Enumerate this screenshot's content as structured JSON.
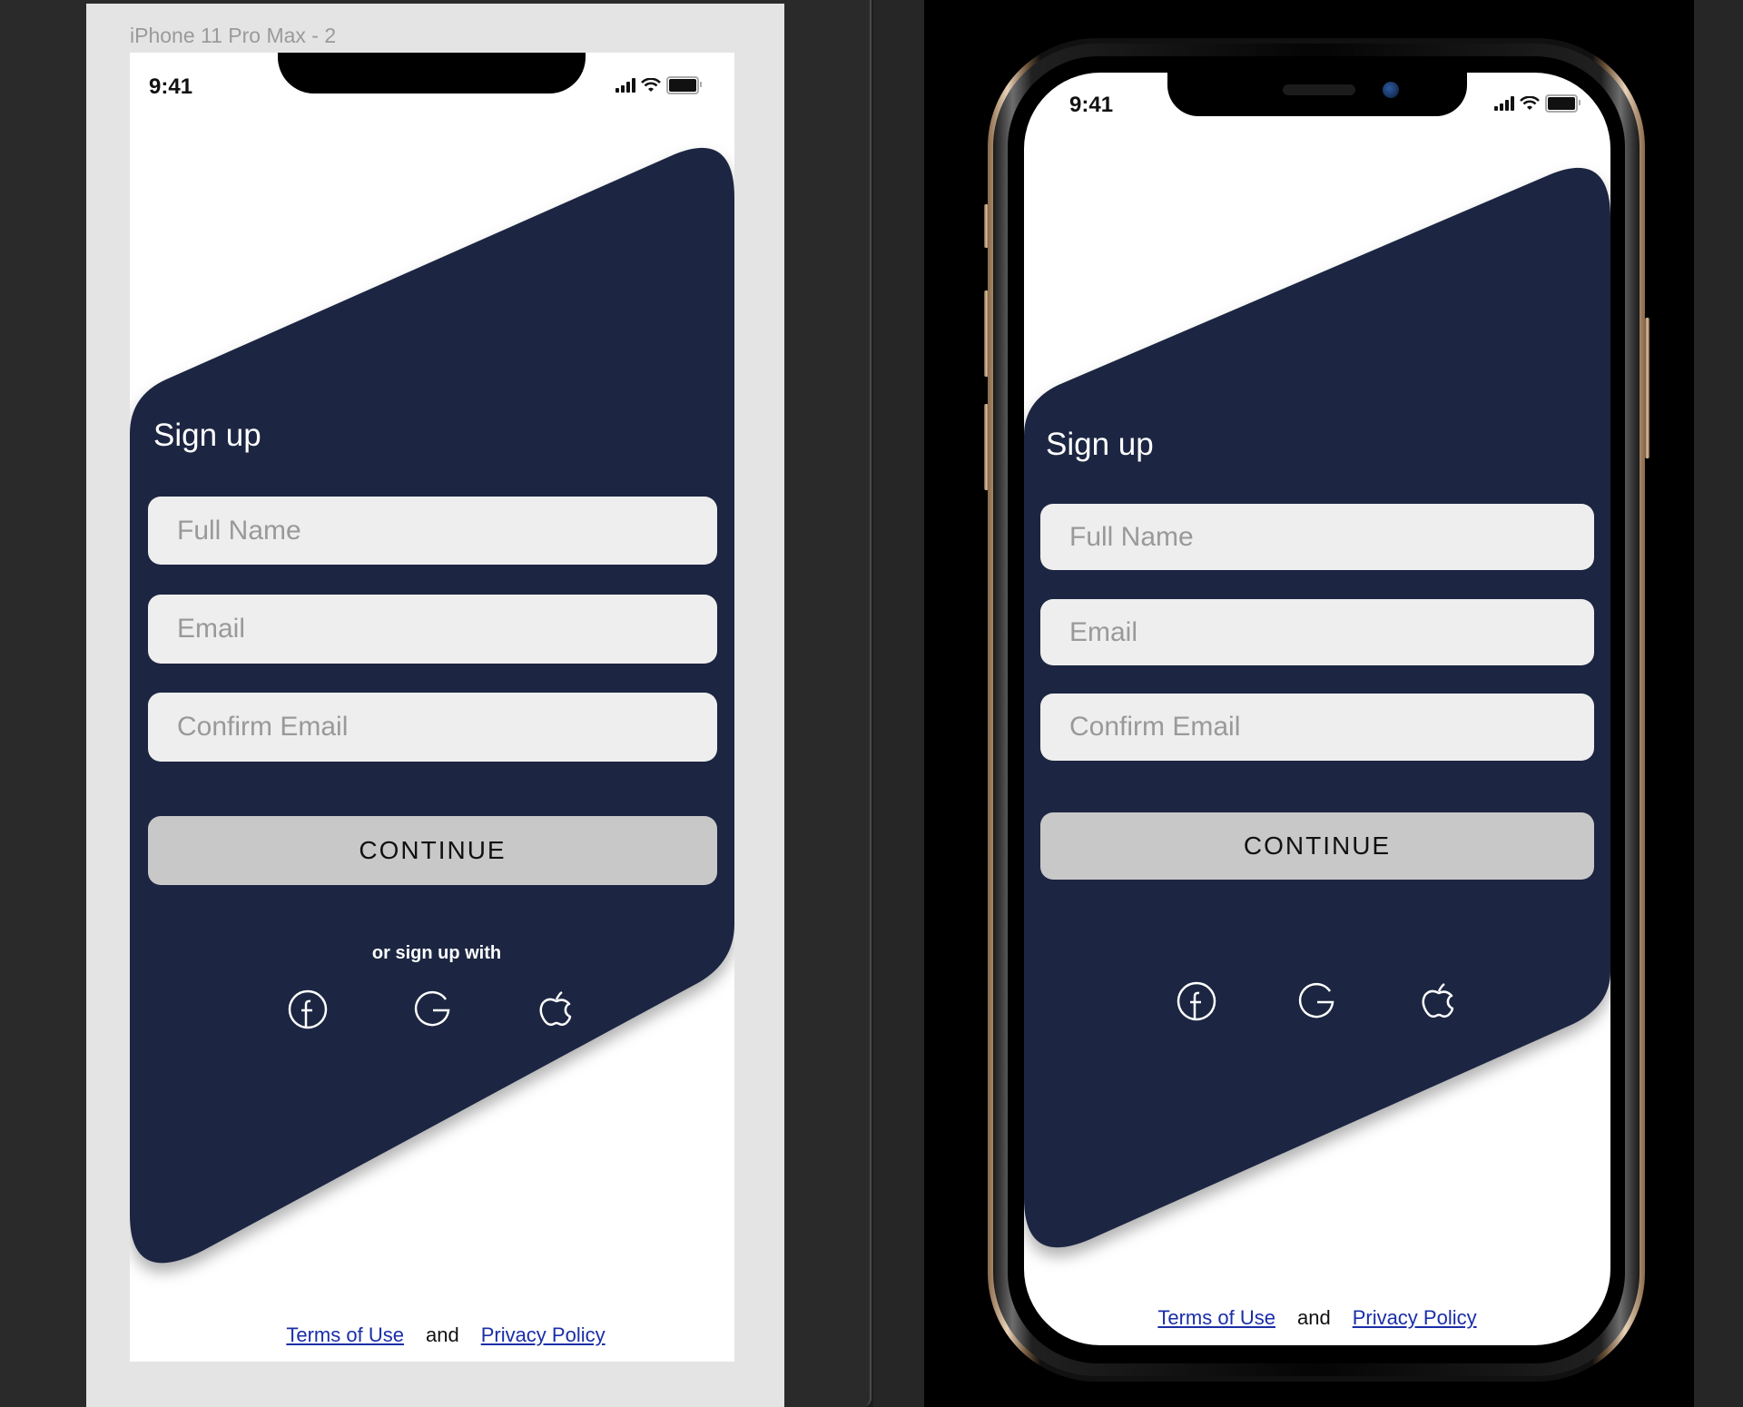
{
  "artboard": {
    "label": "iPhone 11 Pro Max - 2"
  },
  "colors": {
    "shape": "#1e2642",
    "field_bg": "#eeeeee",
    "button_bg": "#c8c8c8",
    "link": "#1a2ea8"
  },
  "status_bar": {
    "time": "9:41",
    "icons": [
      "cellular-signal-icon",
      "wifi-icon",
      "battery-icon"
    ]
  },
  "form": {
    "title": "Sign up",
    "fields": [
      {
        "name": "full-name",
        "placeholder": "Full Name",
        "value": ""
      },
      {
        "name": "email",
        "placeholder": "Email",
        "value": ""
      },
      {
        "name": "confirm-email",
        "placeholder": "Confirm Email",
        "value": ""
      }
    ],
    "continue_label": "CONTINUE",
    "alt_signup_label": "or sign up with",
    "social": [
      "facebook-icon",
      "google-icon",
      "apple-icon"
    ]
  },
  "footer": {
    "terms": "Terms of Use",
    "and": "and",
    "privacy": "Privacy Policy"
  }
}
